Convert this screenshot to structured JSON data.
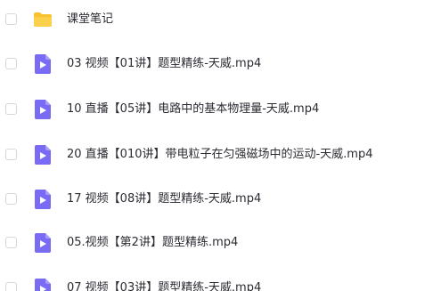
{
  "colors": {
    "folder": "#f7c22e",
    "video": "#7a6bf4",
    "text": "#2b2b33",
    "checkbox_border": "#d6d6db"
  },
  "items": [
    {
      "type": "folder",
      "icon": "folder-icon",
      "name": "课堂笔记"
    },
    {
      "type": "video",
      "icon": "video-file-icon",
      "name": "03 视频【01讲】题型精练-天威.mp4"
    },
    {
      "type": "video",
      "icon": "video-file-icon",
      "name": "10 直播【05讲】电路中的基本物理量-天威.mp4"
    },
    {
      "type": "video",
      "icon": "video-file-icon",
      "name": "20 直播【010讲】带电粒子在匀强磁场中的运动-天威.mp4"
    },
    {
      "type": "video",
      "icon": "video-file-icon",
      "name": "17 视频【08讲】题型精练-天威.mp4"
    },
    {
      "type": "video",
      "icon": "video-file-icon",
      "name": "05.视频【第2讲】题型精练.mp4"
    },
    {
      "type": "video",
      "icon": "video-file-icon",
      "name": "07 视频【03讲】题型精练-天威.mp4"
    }
  ]
}
